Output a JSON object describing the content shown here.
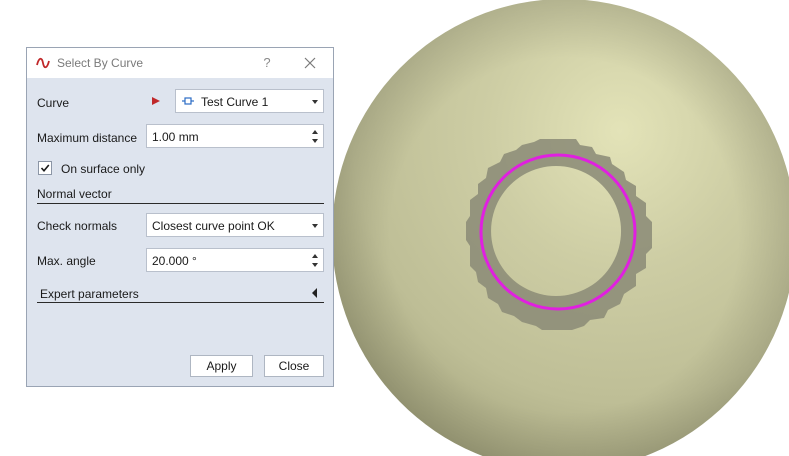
{
  "dialog": {
    "title": "Select By Curve",
    "help_label": "?",
    "curve": {
      "label": "Curve",
      "value": "Test Curve 1"
    },
    "max_distance": {
      "label": "Maximum distance",
      "value": "1.00 mm"
    },
    "on_surface": {
      "label": "On surface only",
      "checked": true
    },
    "normal_section": {
      "title": "Normal vector"
    },
    "check_normals": {
      "label": "Check normals",
      "value": "Closest curve point OK"
    },
    "max_angle": {
      "label": "Max. angle",
      "value": "20.000 °"
    },
    "expert": {
      "label": "Expert parameters"
    },
    "buttons": {
      "apply": "Apply",
      "close": "Close"
    }
  },
  "colors": {
    "selection_curve": "#e020e0",
    "selected_region": "#8c8c78",
    "part_surface": "#c8c89c",
    "dialog_background": "#dee4ee",
    "pick_arrow": "#c0282a",
    "title_icon": "#c0282a"
  },
  "icons": {
    "title": "curve-icon",
    "pick": "pick-arrow-icon",
    "curve_entity": "curve-entity-icon",
    "check": "checkmark-icon",
    "close": "close-icon",
    "expand": "expand-left-icon"
  }
}
